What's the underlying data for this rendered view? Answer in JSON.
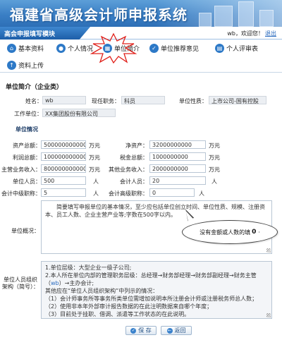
{
  "app": {
    "title": "福建省高级会计师申报系统",
    "module": "高会申报填写模块",
    "welcome": "wb，欢迎您！",
    "logout": "退出"
  },
  "nav": {
    "items": [
      {
        "label": "基本资料",
        "icon": "home-icon"
      },
      {
        "label": "个人情况",
        "icon": "user-icon"
      },
      {
        "label": "单位简介",
        "icon": "building-icon"
      },
      {
        "label": "单位推荐意见",
        "icon": "check-icon"
      },
      {
        "label": "个人评审表",
        "icon": "form-icon"
      },
      {
        "label": "资料上传",
        "icon": "upload-icon"
      }
    ]
  },
  "section": {
    "title": "单位简介（企业类）",
    "name_label": "姓名：",
    "name_value": "wb",
    "position_label": "现任职务：",
    "position_value": "科员",
    "nature_label": "单位性质：",
    "nature_value": "上市公司-国有控股",
    "workplace_label": "工作单位：",
    "workplace_value": "XX集团股份有限公司"
  },
  "unit_info": {
    "title": "单位情况",
    "total_assets_label": "资产总额：",
    "total_assets": "5000000000000",
    "net_assets_label": "净资产：",
    "net_assets": "32000000000",
    "profit_label": "利润总额：",
    "profit": "1000000000000",
    "tax_label": "税金总额：",
    "tax": "1000000000",
    "main_income_label": "主营业务收入：",
    "main_income": "800000000000",
    "other_income_label": "其他业务收入：",
    "other_income": "2000000000",
    "staff_label": "单位人员：",
    "staff": "500",
    "accountants_label": "会计人员：",
    "accountants": "20",
    "mid_label": "会计中级职称：",
    "mid": "5",
    "senior_label": "会计高级职称：",
    "senior": "0",
    "unit_wan": "万元",
    "unit_person": "人"
  },
  "overview": {
    "label": "单位概况：",
    "text": "简要填写申报单位的基本情况，至少应包括单位创立时间、单位性质、规模、注册资本、员工人数、企业主营产业等;字数在500字以内。"
  },
  "org": {
    "label": "单位人员组织架构（简号）：",
    "lines": [
      "1.单位层级：大型企业一级子公司;",
      "2.本人所在单位内部的管理职务层级：总经理→财务部经理→财务部副经理→财务主管（",
      "wb",
      "）→主办会计;",
      "其他应在“单位人员组织架构”中列示的情况：",
      "（1）会计师事务所等事务所类单位需增加说明本所注册会计师或注册税务师总人数；",
      "（2）使用非本年外部审计报告数据的在此注明数据来自哪个年度；",
      "（3）目前处于挂职、借调、派遣等工作状态的在此说明。"
    ]
  },
  "tooltip": {
    "text": "没有金额或人数的填",
    "value": "0",
    "dot": "·"
  },
  "buttons": {
    "save": "保 存",
    "back": "返回"
  },
  "colors": {
    "banner": "#3a7fc5",
    "accent": "#2d79c7",
    "link": "#2a6bbf"
  }
}
